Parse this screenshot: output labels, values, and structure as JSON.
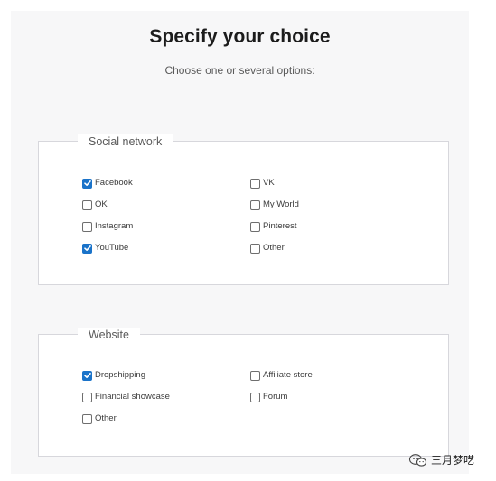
{
  "header": {
    "title": "Specify your choice",
    "subtitle": "Choose one or several options:"
  },
  "groups": {
    "social": {
      "legend": "Social network",
      "options": [
        {
          "label": "Facebook",
          "checked": true
        },
        {
          "label": "VK",
          "checked": false
        },
        {
          "label": "OK",
          "checked": false
        },
        {
          "label": "My World",
          "checked": false
        },
        {
          "label": "Instagram",
          "checked": false
        },
        {
          "label": "Pinterest",
          "checked": false
        },
        {
          "label": "YouTube",
          "checked": true
        },
        {
          "label": "Other",
          "checked": false
        }
      ]
    },
    "website": {
      "legend": "Website",
      "options": [
        {
          "label": "Dropshipping",
          "checked": true
        },
        {
          "label": "Affiliate store",
          "checked": false
        },
        {
          "label": "Financial showcase",
          "checked": false
        },
        {
          "label": "Forum",
          "checked": false
        },
        {
          "label": "Other",
          "checked": false
        }
      ]
    }
  },
  "watermark": {
    "text": "三月梦呓"
  },
  "colors": {
    "accent": "#1a73c9",
    "panel_background": "#f7f7f8",
    "border": "#d7d7dc"
  }
}
